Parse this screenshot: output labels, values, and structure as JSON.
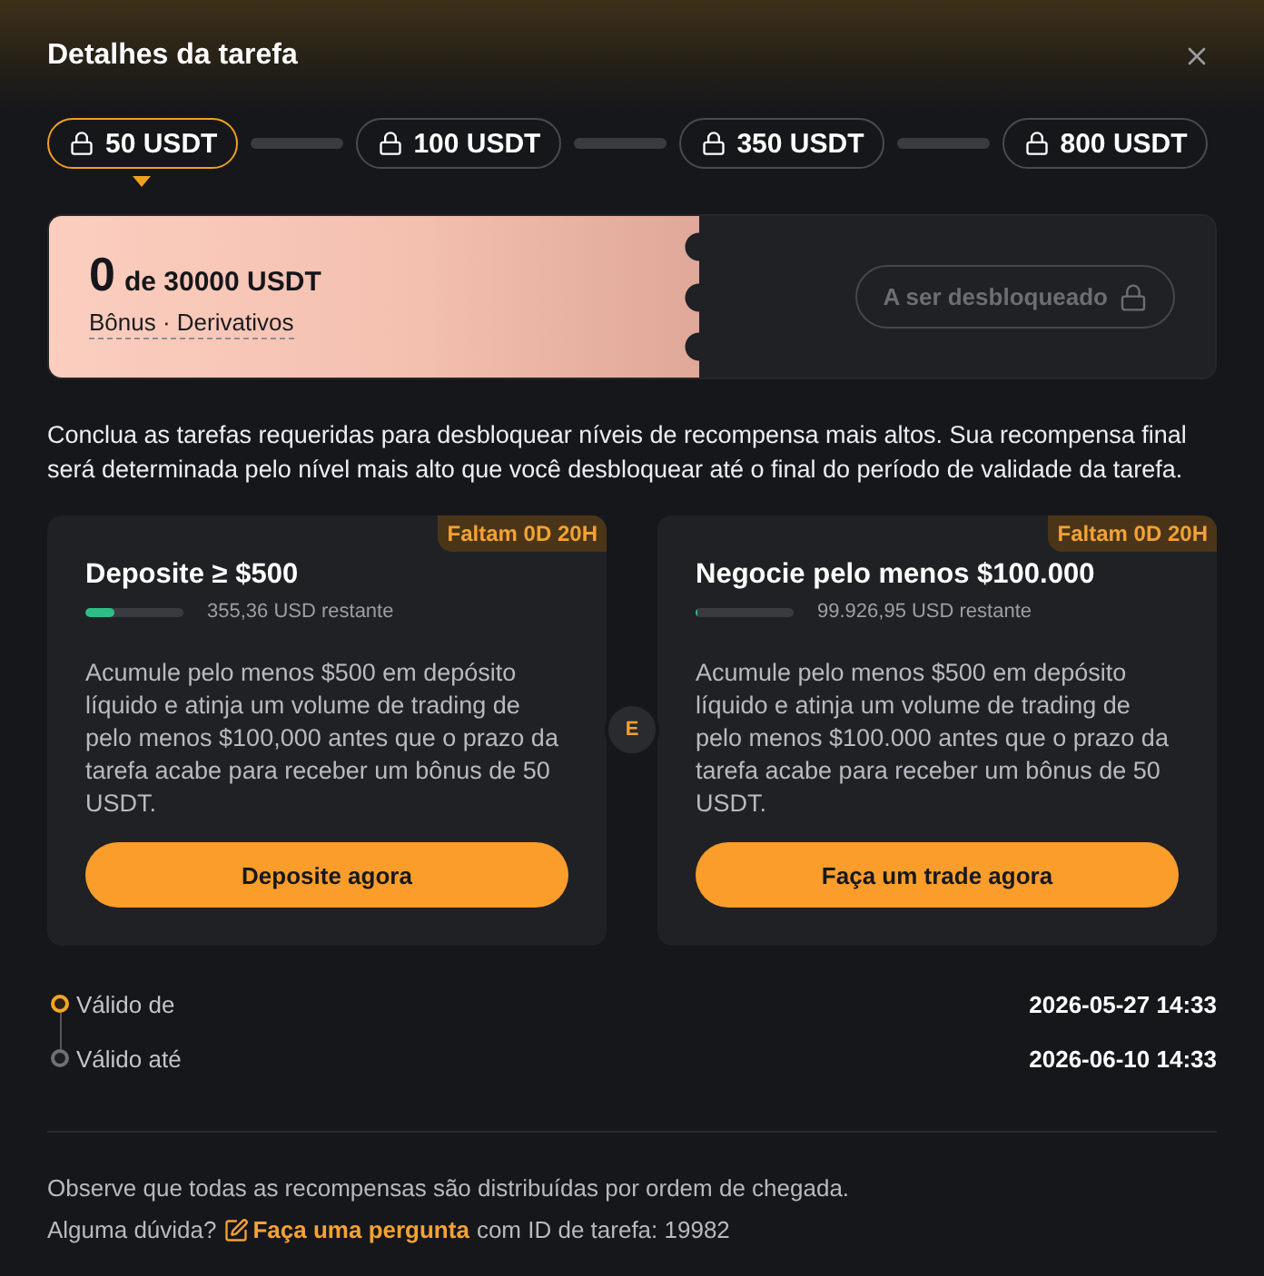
{
  "modal": {
    "title": "Detalhes da tarefa"
  },
  "tiers": [
    {
      "label": "50 USDT",
      "selected": true,
      "locked": true
    },
    {
      "label": "100 USDT",
      "selected": false,
      "locked": true
    },
    {
      "label": "350 USDT",
      "selected": false,
      "locked": true
    },
    {
      "label": "800 USDT",
      "selected": false,
      "locked": true
    }
  ],
  "reward": {
    "amount": "0",
    "total": "de 30000 USDT",
    "tags": "Bônus · Derivativos",
    "status_button": "A ser desbloqueado"
  },
  "intro": "Conclua as tarefas requeridas para desbloquear níveis de recompensa mais altos. Sua recompensa final será determinada pelo nível mais alto que você desbloquear até o final do período de validade da tarefa.",
  "tasks": [
    {
      "badge": "Faltam 0D 20H",
      "title": "Deposite ≥ $500",
      "level": 0.29,
      "remaining": "355,36 USD restante",
      "description": "Acumule pelo menos $500 em depósito líquido e atinja um volume de trading de pelo menos $100,000 antes que o prazo da tarefa acabe para receber um bônus de 50 USDT.",
      "button": "Deposite agora"
    },
    {
      "badge": "Faltam 0D 20H",
      "title": "Negocie pelo menos $100.000",
      "level": 0,
      "remaining": "99.926,95 USD restante",
      "description": "Acumule pelo menos $500 em depósito líquido e atinja um volume de trading de pelo menos $100.000 antes que o prazo da tarefa acabe para receber um bônus de 50 USDT.",
      "button": "Faça um trade agora"
    }
  ],
  "connector": "E",
  "validity": [
    {
      "label": "Válido de",
      "value": "2026-05-27 14:33",
      "active": true
    },
    {
      "label": "Válido até",
      "value": "2026-06-10 14:33",
      "active": false
    }
  ],
  "notice": "Observe que todas as recompensas são distribuídas por ordem de chegada.",
  "help": {
    "prefix": "Alguma dúvida?",
    "link": "Faça uma pergunta",
    "suffix": "com ID de tarefa: 19982"
  }
}
